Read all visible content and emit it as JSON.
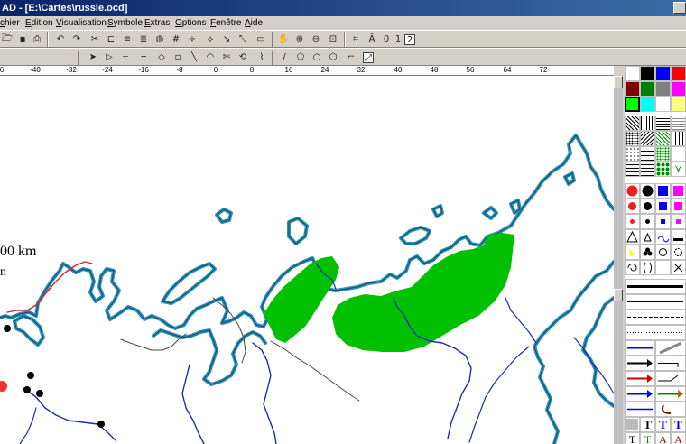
{
  "window": {
    "title": "AD - [E:\\Cartes\\russie.ocd]"
  },
  "menu": [
    "chier",
    "Edition",
    "Visualisation",
    "Symbole",
    "Extras",
    "Options",
    "Fenêtre",
    "Aide"
  ],
  "toolbar1": {
    "layer_labels": [
      "0",
      "1",
      "2"
    ]
  },
  "ruler": {
    "ticks": [
      "6",
      "-40",
      "-32",
      "-24",
      "-16",
      "-8",
      "0",
      "8",
      "16",
      "24",
      "32",
      "40",
      "48",
      "56",
      "64",
      "72"
    ]
  },
  "map": {
    "scale_text": "00 km",
    "scale_unit": "n",
    "colors": {
      "coast": "#2f8fb5",
      "coast_dark": "#0b4f73",
      "river": "#1a2fb0",
      "border": "#444444",
      "region": "#00c000",
      "line_red": "#e02020"
    }
  },
  "palette": {
    "colors": [
      "#ffffff",
      "#000000",
      "#0000ff",
      "#ff0000",
      "#800000",
      "#008000",
      "#808080",
      "#ff00ff",
      "#00ff00",
      "#00ffff",
      "#ffffff",
      "#ffff80"
    ]
  }
}
